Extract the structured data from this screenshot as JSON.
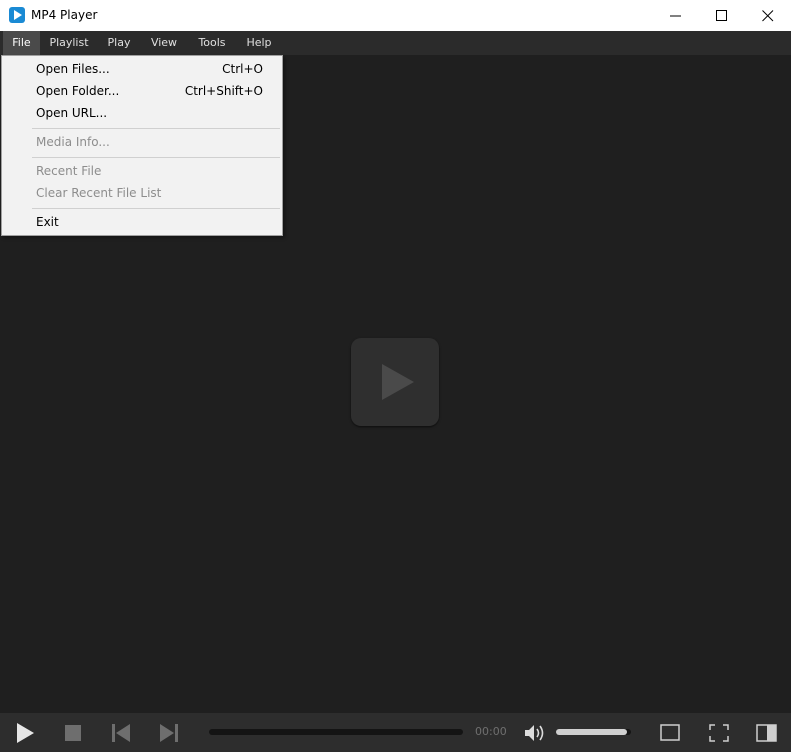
{
  "window": {
    "title": "MP4 Player"
  },
  "menubar": {
    "items": [
      {
        "label": "File",
        "active": true
      },
      {
        "label": "Playlist"
      },
      {
        "label": "Play"
      },
      {
        "label": "View"
      },
      {
        "label": "Tools"
      },
      {
        "label": "Help"
      }
    ]
  },
  "file_menu": {
    "items": [
      {
        "label": "Open Files...",
        "shortcut": "Ctrl+O",
        "enabled": true
      },
      {
        "label": "Open Folder...",
        "shortcut": "Ctrl+Shift+O",
        "enabled": true
      },
      {
        "label": "Open URL...",
        "shortcut": "",
        "enabled": true
      },
      {
        "label": "Media Info...",
        "shortcut": "",
        "enabled": false
      },
      {
        "label": "Recent File",
        "shortcut": "",
        "enabled": false
      },
      {
        "label": "Clear Recent File List",
        "shortcut": "",
        "enabled": false
      },
      {
        "label": "Exit",
        "shortcut": "",
        "enabled": true
      }
    ]
  },
  "controls": {
    "time": "00:00",
    "seek_progress": 0,
    "volume_level": 0.95
  },
  "colors": {
    "background": "#1f1f1f",
    "menubar": "#2b2b2b",
    "controlbar": "#2d2d2d",
    "menu_bg": "#f2f2f2",
    "accent": "#1a8ad4"
  },
  "icons": [
    "app-icon",
    "minimize-icon",
    "maximize-icon",
    "close-icon",
    "play-icon",
    "stop-icon",
    "previous-icon",
    "next-icon",
    "volume-icon",
    "window-mode-icon",
    "fullscreen-icon",
    "playlist-toggle-icon"
  ]
}
